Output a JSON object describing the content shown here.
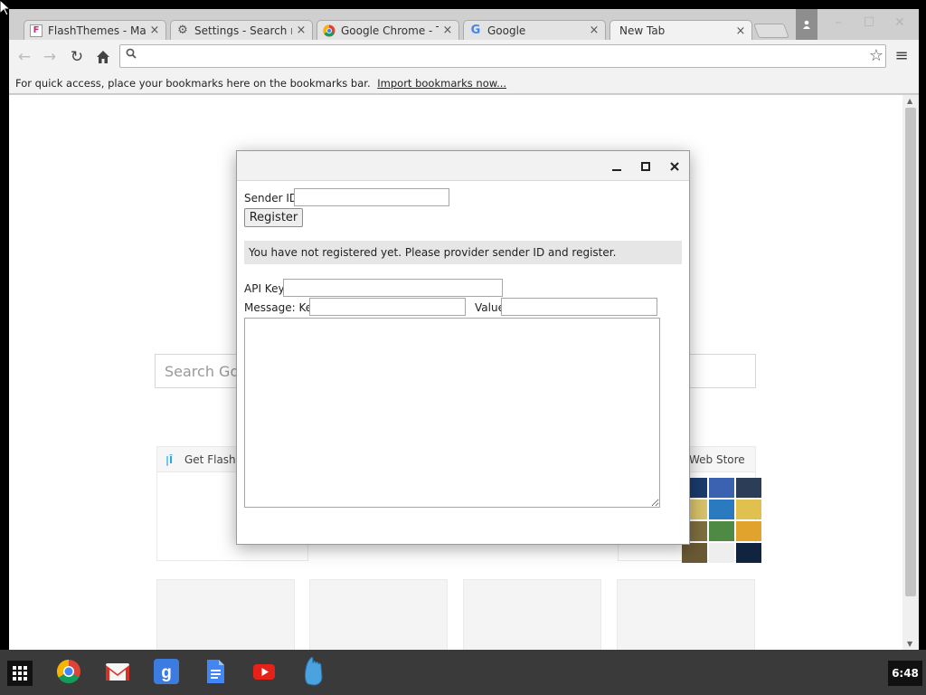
{
  "browser": {
    "tabs": [
      {
        "title": "FlashThemes - Make",
        "icon": "flashthemes-icon"
      },
      {
        "title": "Settings - Search res",
        "icon": "gear-icon"
      },
      {
        "title": "Google Chrome - Th",
        "icon": "chrome-icon"
      },
      {
        "title": "Google",
        "icon": "google-g-icon"
      },
      {
        "title": "New Tab",
        "icon": "",
        "active": true
      }
    ],
    "tab_close_glyph": "×",
    "omnibox_value": "",
    "bookmarks_bar": {
      "message": "For quick access, place your bookmarks here on the bookmarks bar.",
      "import_link": "Import bookmarks now..."
    }
  },
  "new_tab_page": {
    "search_placeholder": "Search Goo",
    "tiles": [
      {
        "title": "Get Flash -",
        "icon": "flash-icon"
      },
      {
        "title": "Web Store",
        "icon": "web-store-icon"
      }
    ]
  },
  "dialog": {
    "sender_id_label": "Sender ID:",
    "sender_id_value": "",
    "register_label": "Register",
    "status_text": "You have not registered yet. Please provider sender ID and register.",
    "api_key_label": "API Key:",
    "api_key_value": "",
    "message_key_label": "Message: Key",
    "message_key_value": "",
    "value_label": "Value",
    "value_value": "",
    "message_body": ""
  },
  "shelf": {
    "apps": [
      "chrome-app-icon",
      "gmail-app-icon",
      "google-search-app-icon",
      "docs-app-icon",
      "youtube-app-icon",
      "gcm-app-icon"
    ],
    "clock": "6:48"
  },
  "colors": {
    "shelf_bg": "#3a3a3a",
    "tabstrip_bg": "#cfcfcf",
    "toolbar_bg": "#f2f2f2",
    "status_bg": "#e6e6e6"
  }
}
